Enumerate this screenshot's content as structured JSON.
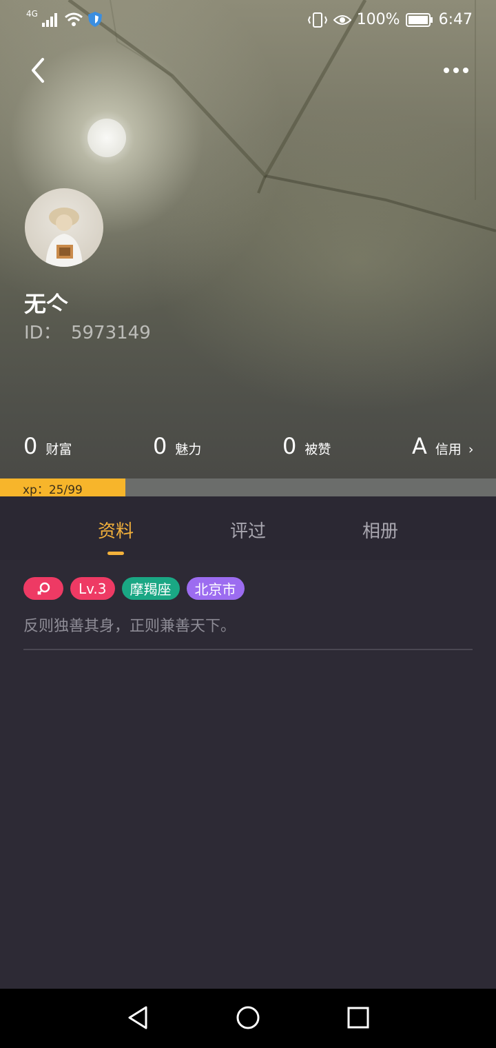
{
  "status_bar": {
    "network": "4G",
    "battery": "100%",
    "time": "6:47"
  },
  "header": {
    "nickname": "无亽",
    "id_label": "ID：",
    "id_value": "5973149"
  },
  "stats": [
    {
      "value": "0",
      "label": "财富"
    },
    {
      "value": "0",
      "label": "魅力"
    },
    {
      "value": "0",
      "label": "被赞"
    },
    {
      "value": "A",
      "label": "信用"
    }
  ],
  "xp": {
    "text": "xp：25/99",
    "current": 25,
    "max": 99,
    "color": "#f7b52b"
  },
  "tabs": [
    {
      "label": "资料",
      "active": true
    },
    {
      "label": "评过",
      "active": false
    },
    {
      "label": "相册",
      "active": false
    }
  ],
  "profile": {
    "tags": {
      "gender_icon": "female-icon",
      "level": "Lv.3",
      "zodiac": "摩羯座",
      "city": "北京市"
    },
    "bio": "反则独善其身，正则兼善天下。"
  },
  "colors": {
    "accent": "#f3b13b",
    "gender_tag": "#ee3a64",
    "zodiac_tag": "#1aa784",
    "city_tag": "#9c6cf0",
    "background": "#2d2a35"
  },
  "icons": [
    "back-icon",
    "more-icon",
    "signal-icon",
    "wifi-icon",
    "shield-icon",
    "vibrate-icon",
    "eye-icon",
    "battery-icon",
    "nav-back-icon",
    "nav-home-icon",
    "nav-recents-icon"
  ]
}
